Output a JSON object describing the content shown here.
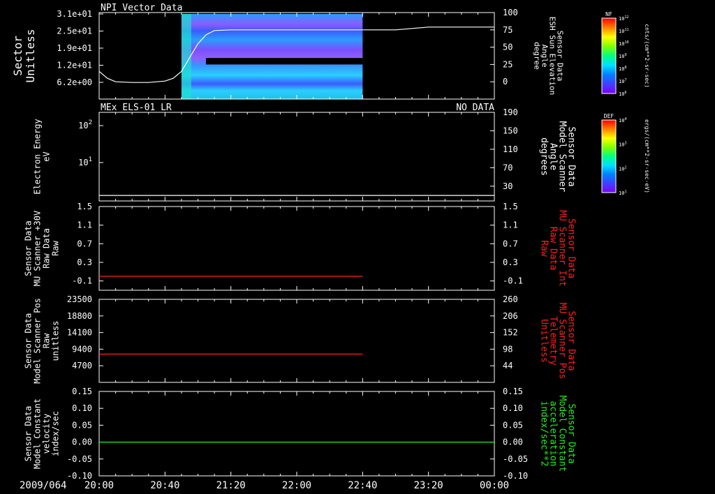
{
  "colors": {
    "background": "#000000",
    "axis": "#ffffff",
    "red": "#ff2020",
    "green": "#22ee22",
    "white": "#ffffff"
  },
  "time_axis": {
    "date_label": "2009/064",
    "ticks": [
      "20:00",
      "20:40",
      "21:20",
      "22:00",
      "22:40",
      "23:20",
      "00:00"
    ],
    "range": [
      "20:00",
      "00:00"
    ]
  },
  "colorbars": [
    {
      "label": "NF",
      "units": "cnts/(cm**2-sr-sec)",
      "ticks": [
        "10^12",
        "10^11",
        "10^10",
        "10^9",
        "10^8",
        "10^7",
        "10^6"
      ],
      "colors": [
        "#ff0000",
        "#ff8000",
        "#ffff00",
        "#80ff00",
        "#00ff80",
        "#00e0ff",
        "#0080ff",
        "#4040ff",
        "#8000ff"
      ]
    },
    {
      "label": "DEF",
      "units": "ergs/(cm**2-sr-sec-eV)",
      "ticks": [
        "10^4",
        "10^3",
        "10^2",
        "10^1"
      ],
      "colors": [
        "#ff0000",
        "#ff8000",
        "#ffff00",
        "#80ff00",
        "#00ff80",
        "#00e0ff",
        "#0080ff",
        "#4040ff",
        "#8000ff"
      ]
    }
  ],
  "chart_data": [
    {
      "type": "heatmap",
      "title": "NPI Vector Data",
      "status": "",
      "ylabel": [
        "Sector",
        "Unitless"
      ],
      "yticks": [
        "3.1e+01",
        "2.5e+01",
        "1.9e+01",
        "1.2e+01",
        "6.2e+00"
      ],
      "ylabel2": [
        "Sensor Data",
        "ESH Sun Elevation",
        "Angle",
        "degree"
      ],
      "y2ticks": [
        "100",
        "75",
        "50",
        "25",
        "0"
      ],
      "y2lim": [
        -25,
        100
      ],
      "heatmap_time_range": [
        "20:50",
        "22:40"
      ],
      "heatmap_gap_sectors": [
        12.8,
        15.2
      ],
      "series": [
        {
          "axis": "right",
          "color": "#ffffff",
          "x": [
            "20:00",
            "20:05",
            "20:10",
            "20:20",
            "20:30",
            "20:40",
            "20:45",
            "20:50",
            "20:55",
            "21:00",
            "21:05",
            "21:10",
            "21:20",
            "22:00",
            "22:40",
            "23:00",
            "23:10",
            "23:20",
            "00:00"
          ],
          "values": [
            15,
            5,
            0,
            -1,
            -1,
            1,
            5,
            15,
            35,
            55,
            68,
            74,
            75,
            75,
            75,
            75,
            77,
            79,
            79
          ]
        }
      ]
    },
    {
      "type": "line",
      "title": "MEx ELS-01 LR",
      "status": "NO DATA",
      "ylabel": [
        "Electron Energy",
        "eV"
      ],
      "yticks": [
        "10^2",
        "10^1"
      ],
      "ylabel2": [
        "Sensor Data",
        "Model Scanner",
        "Angle",
        "degrees"
      ],
      "y2ticks": [
        "190",
        "150",
        "110",
        "70",
        "30"
      ],
      "y2lim": [
        -2,
        190
      ],
      "series": [
        {
          "axis": "right",
          "color": "#ffffff",
          "x": [
            "20:00",
            "00:00"
          ],
          "values": [
            10,
            10
          ]
        }
      ]
    },
    {
      "type": "line",
      "title": "",
      "status": "",
      "ylabel": [
        "Sensor Data",
        "MU Scanner +30V",
        "Raw Data",
        "Raw"
      ],
      "yticks": [
        "1.5",
        "1.1",
        "0.7",
        "0.3",
        "-0.1"
      ],
      "ylim": [
        -0.3,
        1.5
      ],
      "ylabel2": [
        "Sensor Data",
        "MU Scanner Int",
        "Raw Data",
        "Raw"
      ],
      "y2ticks": [
        "1.5",
        "1.1",
        "0.7",
        "0.3",
        "-0.1"
      ],
      "y2lim": [
        -0.3,
        1.5
      ],
      "label2_color": "#ff2020",
      "series": [
        {
          "axis": "left",
          "color": "#ff2020",
          "x": [
            "20:00",
            "22:40"
          ],
          "values": [
            0,
            0
          ]
        }
      ]
    },
    {
      "type": "line",
      "title": "",
      "status": "",
      "ylabel": [
        "Sensor Data",
        "Model Scanner Pos",
        "Raw",
        "unitless"
      ],
      "yticks": [
        "23500",
        "18800",
        "14100",
        "9400",
        "4700"
      ],
      "ylim": [
        0,
        23500
      ],
      "ylabel2": [
        "Sensor Data",
        "MU Scanner Pos",
        "Telemetry",
        "Unitless"
      ],
      "y2ticks": [
        "260",
        "206",
        "152",
        "98",
        "44"
      ],
      "y2lim": [
        -10,
        260
      ],
      "label2_color": "#ff2020",
      "series": [
        {
          "axis": "left",
          "color": "#ff2020",
          "x": [
            "20:00",
            "22:40"
          ],
          "values": [
            8000,
            8000
          ]
        }
      ]
    },
    {
      "type": "line",
      "title": "",
      "status": "",
      "ylabel": [
        "Sensor Data",
        "Model Constant",
        "velocity",
        "index/sec"
      ],
      "yticks": [
        "0.15",
        "0.10",
        "0.05",
        "0.00",
        "-0.05",
        "-0.10"
      ],
      "ylim": [
        -0.1,
        0.15
      ],
      "ylabel2": [
        "Sensor Data",
        "Model Constant",
        "acceleration",
        "index/sec**2"
      ],
      "y2ticks": [
        "0.15",
        "0.10",
        "0.05",
        "0.00",
        "-0.05",
        "-0.10"
      ],
      "y2lim": [
        -0.1,
        0.15
      ],
      "label2_color": "#22ee22",
      "series": [
        {
          "axis": "left",
          "color": "#22ee22",
          "x": [
            "20:00",
            "00:00"
          ],
          "values": [
            0,
            0
          ]
        }
      ]
    }
  ]
}
